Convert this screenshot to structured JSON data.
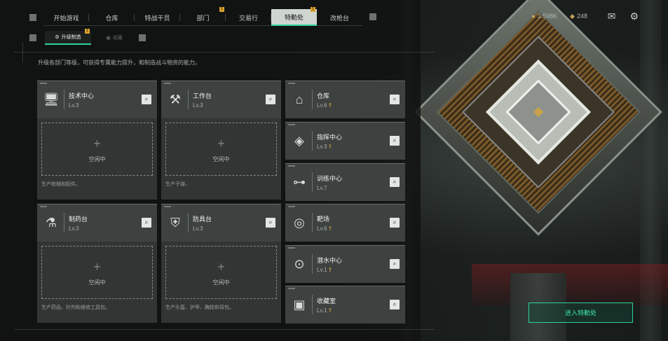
{
  "nav": {
    "tabs": [
      {
        "label": "开始游戏",
        "badge": ""
      },
      {
        "label": "仓库",
        "badge": ""
      },
      {
        "label": "特战干员",
        "badge": ""
      },
      {
        "label": "部门",
        "badge": "1"
      },
      {
        "label": "交易行",
        "badge": ""
      },
      {
        "label": "特勤处",
        "badge": "1"
      },
      {
        "label": "改枪台",
        "badge": ""
      }
    ],
    "active_index": 5
  },
  "currency": {
    "money": "3.598K",
    "tokens": "248"
  },
  "subnav": {
    "tabs": [
      {
        "label": "升级制造",
        "badge": "1"
      },
      {
        "label": "收藏",
        "badge": ""
      }
    ]
  },
  "description": "升级各部门等级，可获得专属能力提升，和制造战斗物资的能力。",
  "production_cards": [
    {
      "name": "技术中心",
      "level": "Lv.3",
      "icon": "computer-icon",
      "idle_label": "空闲中",
      "footer": "生产枪械和配件。"
    },
    {
      "name": "工作台",
      "level": "Lv.3",
      "icon": "tools-icon",
      "idle_label": "空闲中",
      "footer": "生产子弹。"
    },
    {
      "name": "制药台",
      "level": "Lv.3",
      "icon": "microscope-icon",
      "idle_label": "空闲中",
      "footer": "生产药品、针剂和维修工具包。"
    },
    {
      "name": "防具台",
      "level": "Lv.3",
      "icon": "armor-icon",
      "idle_label": "空闲中",
      "footer": "生产头盔、护甲、胸挂和背包。"
    }
  ],
  "facility_cards": [
    {
      "name": "仓库",
      "level": "Lv.6",
      "upgradable": true,
      "icon": "warehouse-icon"
    },
    {
      "name": "指挥中心",
      "level": "Lv.3",
      "upgradable": true,
      "icon": "command-icon"
    },
    {
      "name": "训练中心",
      "level": "Lv.7",
      "upgradable": false,
      "icon": "dumbbell-icon"
    },
    {
      "name": "靶场",
      "level": "Lv.6",
      "upgradable": true,
      "icon": "target-icon"
    },
    {
      "name": "潜水中心",
      "level": "Lv.1",
      "upgradable": true,
      "icon": "diving-mask-icon"
    },
    {
      "name": "收藏室",
      "level": "Lv.1",
      "upgradable": true,
      "icon": "collection-icon"
    }
  ],
  "enter_button": "进入特勤处",
  "colors": {
    "accent": "#2fd39a",
    "badge": "#d89f2d",
    "upgrade_arrow": "#d8a33a"
  }
}
